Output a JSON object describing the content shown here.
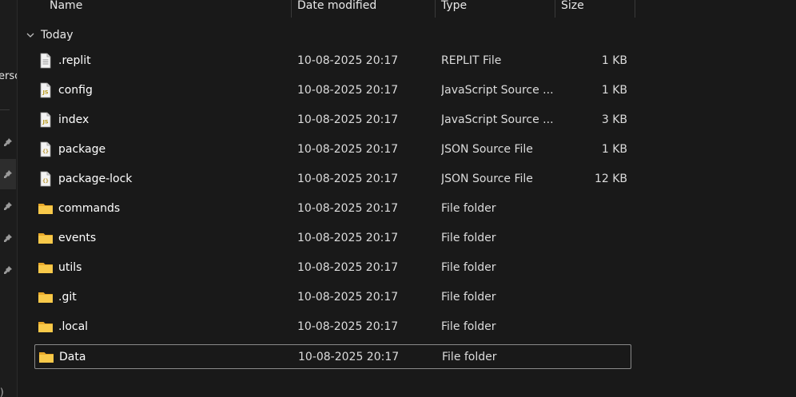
{
  "nav": {
    "fragment_text": "ersc",
    "bottom_fragment": ")"
  },
  "columns": {
    "name": "Name",
    "date": "Date modified",
    "type": "Type",
    "size": "Size"
  },
  "group": {
    "label": "Today"
  },
  "files": [
    {
      "name": ".replit",
      "date": "10-08-2025 20:17",
      "type": "REPLIT File",
      "size": "1 KB",
      "icon": "text-file-icon"
    },
    {
      "name": "config",
      "date": "10-08-2025 20:17",
      "type": "JavaScript Source ...",
      "size": "1 KB",
      "icon": "js-file-icon"
    },
    {
      "name": "index",
      "date": "10-08-2025 20:17",
      "type": "JavaScript Source ...",
      "size": "3 KB",
      "icon": "js-file-icon"
    },
    {
      "name": "package",
      "date": "10-08-2025 20:17",
      "type": "JSON Source File",
      "size": "1 KB",
      "icon": "json-file-icon"
    },
    {
      "name": "package-lock",
      "date": "10-08-2025 20:17",
      "type": "JSON Source File",
      "size": "12 KB",
      "icon": "json-file-icon"
    },
    {
      "name": "commands",
      "date": "10-08-2025 20:17",
      "type": "File folder",
      "size": "",
      "icon": "folder-icon"
    },
    {
      "name": "events",
      "date": "10-08-2025 20:17",
      "type": "File folder",
      "size": "",
      "icon": "folder-icon"
    },
    {
      "name": "utils",
      "date": "10-08-2025 20:17",
      "type": "File folder",
      "size": "",
      "icon": "folder-icon"
    },
    {
      "name": ".git",
      "date": "10-08-2025 20:17",
      "type": "File folder",
      "size": "",
      "icon": "folder-icon"
    },
    {
      "name": ".local",
      "date": "10-08-2025 20:17",
      "type": "File folder",
      "size": "",
      "icon": "folder-icon"
    },
    {
      "name": "Data",
      "date": "10-08-2025 20:17",
      "type": "File folder",
      "size": "",
      "icon": "folder-icon"
    }
  ],
  "selected_index": 10,
  "colors": {
    "background": "#191919",
    "folder": "#f5c242",
    "js_badge": "#d7c13b",
    "json_badge": "#c9a227"
  }
}
